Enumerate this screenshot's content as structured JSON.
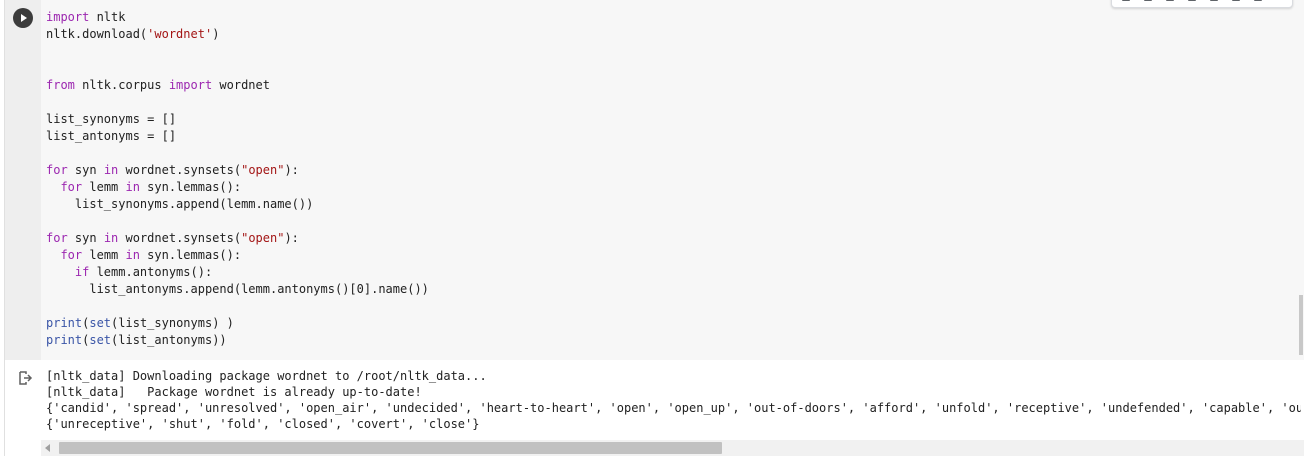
{
  "cell": {
    "run_button_icon": "play-icon",
    "code_lines": [
      [
        {
          "t": "import",
          "c": "kw"
        },
        {
          "t": " nltk"
        }
      ],
      [
        {
          "t": "nltk.download("
        },
        {
          "t": "'wordnet'",
          "c": "str"
        },
        {
          "t": ")"
        }
      ],
      [],
      [],
      [
        {
          "t": "from",
          "c": "kw"
        },
        {
          "t": " nltk.corpus "
        },
        {
          "t": "import",
          "c": "kw"
        },
        {
          "t": " wordnet"
        }
      ],
      [],
      [
        {
          "t": "list_synonyms = []"
        }
      ],
      [
        {
          "t": "list_antonyms = []"
        }
      ],
      [],
      [
        {
          "t": "for",
          "c": "kw"
        },
        {
          "t": " syn "
        },
        {
          "t": "in",
          "c": "kw"
        },
        {
          "t": " wordnet.synsets("
        },
        {
          "t": "\"open\"",
          "c": "str"
        },
        {
          "t": "):"
        }
      ],
      [
        {
          "t": "  "
        },
        {
          "t": "for",
          "c": "kw"
        },
        {
          "t": " lemm "
        },
        {
          "t": "in",
          "c": "kw"
        },
        {
          "t": " syn.lemmas():"
        }
      ],
      [
        {
          "t": "    list_synonyms.append(lemm.name())"
        }
      ],
      [],
      [
        {
          "t": "for",
          "c": "kw"
        },
        {
          "t": " syn "
        },
        {
          "t": "in",
          "c": "kw"
        },
        {
          "t": " wordnet.synsets("
        },
        {
          "t": "\"open\"",
          "c": "str"
        },
        {
          "t": "):"
        }
      ],
      [
        {
          "t": "  "
        },
        {
          "t": "for",
          "c": "kw"
        },
        {
          "t": " lemm "
        },
        {
          "t": "in",
          "c": "kw"
        },
        {
          "t": " syn.lemmas():"
        }
      ],
      [
        {
          "t": "    "
        },
        {
          "t": "if",
          "c": "kw"
        },
        {
          "t": " lemm.antonyms():"
        }
      ],
      [
        {
          "t": "      list_antonyms.append(lemm.antonyms()[0].name())"
        }
      ],
      [],
      [
        {
          "t": "print",
          "c": "fn"
        },
        {
          "t": "("
        },
        {
          "t": "set",
          "c": "fn"
        },
        {
          "t": "(list_synonyms) )"
        }
      ],
      [
        {
          "t": "print",
          "c": "fn"
        },
        {
          "t": "("
        },
        {
          "t": "set",
          "c": "fn"
        },
        {
          "t": "(list_antonyms))"
        }
      ]
    ],
    "output_icon": "output-redirect-icon",
    "output_lines": [
      "[nltk_data] Downloading package wordnet to /root/nltk_data...",
      "[nltk_data]   Package wordnet is already up-to-date!",
      "{'candid', 'spread', 'unresolved', 'open_air', 'undecided', 'heart-to-heart', 'open', 'open_up', 'out-of-doors', 'afford', 'unfold', 'receptive', 'undefended', 'capable', 'outdoors',",
      "{'unreceptive', 'shut', 'fold', 'closed', 'covert', 'close'}"
    ],
    "scroll_thumb_fraction": 0.54
  },
  "colors": {
    "keyword": "#9c27b0",
    "function": "#3a55a7",
    "string": "#a31515"
  }
}
